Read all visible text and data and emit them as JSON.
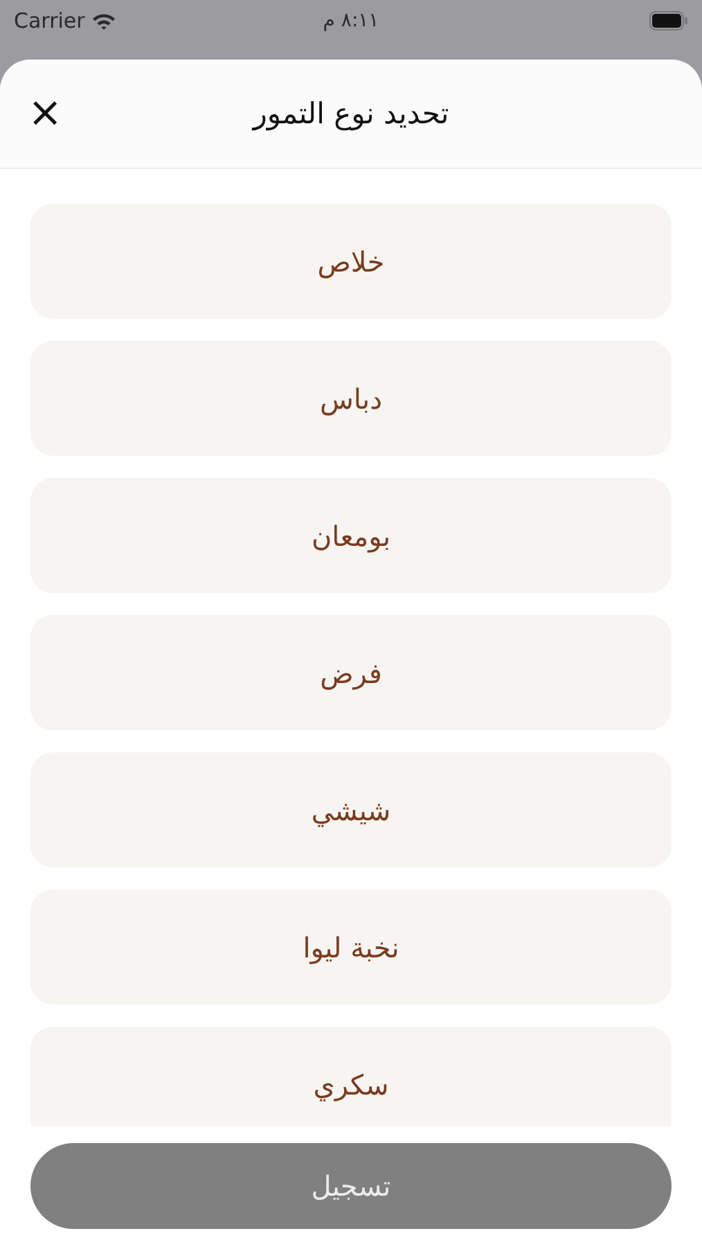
{
  "status_bar": {
    "carrier": "Carrier",
    "time": "٨:١١ م"
  },
  "sheet": {
    "title": "تحديد نوع التمور",
    "close": "×"
  },
  "options": [
    {
      "label": "خلاص",
      "selected": false
    },
    {
      "label": "دباس",
      "selected": false
    },
    {
      "label": "بومعان",
      "selected": false
    },
    {
      "label": "فرض",
      "selected": false
    },
    {
      "label": "شيشي",
      "selected": false
    },
    {
      "label": "نخبة ليوا",
      "selected": false
    },
    {
      "label": "سكري",
      "selected": false
    }
  ],
  "submit_button": {
    "label": "تسجيل",
    "disabled": true
  }
}
